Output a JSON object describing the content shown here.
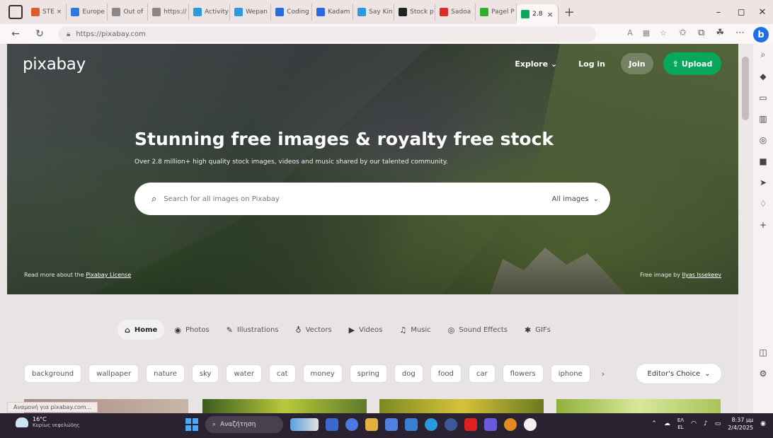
{
  "browser": {
    "tabs": [
      {
        "label": "STE ×",
        "color": "#e05a2a"
      },
      {
        "label": "Europe",
        "color": "#2a7ae0"
      },
      {
        "label": "Out of",
        "color": "#888888"
      },
      {
        "label": "https://",
        "color": "#888888"
      },
      {
        "label": "Activity",
        "color": "#2a9ae0"
      },
      {
        "label": "Wepan",
        "color": "#2a9ae0"
      },
      {
        "label": "Coding",
        "color": "#2a6ae0"
      },
      {
        "label": "Kadam",
        "color": "#2a6ae0"
      },
      {
        "label": "Say Kin",
        "color": "#2a9ae0"
      },
      {
        "label": "Stock p",
        "color": "#222222"
      },
      {
        "label": "Sadoa",
        "color": "#e02a2a"
      },
      {
        "label": "Pagel P",
        "color": "#2ab02a"
      },
      {
        "label": "2.8",
        "color": "#07a85a",
        "active": true
      }
    ],
    "new_tab": "+",
    "minimize": "–",
    "maximize": "◻",
    "close": "✕",
    "back": "←",
    "refresh": "↻",
    "url": "https://pixabay.com",
    "bing": "b"
  },
  "hero": {
    "logo": "pixabay",
    "nav": {
      "explore": "Explore ⌄",
      "login": "Log in",
      "join": "Join",
      "upload": "Upload"
    },
    "title": "Stunning free images & royalty free stock",
    "subtitle": "Over 2.8 million+ high quality stock images, videos and music shared by our talented community.",
    "search_placeholder": "Search for all images on Pixabay",
    "search_filter": "All images",
    "license_prefix": "Read more about the ",
    "license_link": "Pixabay License",
    "credit_prefix": "Free image by ",
    "credit_link": "Ilyas Issekeev"
  },
  "categories": [
    {
      "icon": "⌂",
      "label": "Home",
      "active": true
    },
    {
      "icon": "◉",
      "label": "Photos"
    },
    {
      "icon": "✎",
      "label": "Illustrations"
    },
    {
      "icon": "♁",
      "label": "Vectors"
    },
    {
      "icon": "▶",
      "label": "Videos"
    },
    {
      "icon": "♫",
      "label": "Music"
    },
    {
      "icon": "◎",
      "label": "Sound Effects"
    },
    {
      "icon": "✱",
      "label": "GIFs"
    }
  ],
  "tags": [
    "background",
    "wallpaper",
    "nature",
    "sky",
    "water",
    "cat",
    "money",
    "spring",
    "dog",
    "food",
    "car",
    "flowers",
    "iphone"
  ],
  "tags_next": "›",
  "editors_choice": "Editor's Choice",
  "status_bar_text": "Αναμονή για pixabay.com...",
  "taskbar": {
    "weather_temp": "16°C",
    "weather_desc": "Κυρίως νεφελώδης",
    "search": "Αναζήτηση",
    "lang_top": "ΕΛ",
    "lang_bottom": "EL",
    "time": "8:37 μμ",
    "date": "2/4/2025"
  }
}
